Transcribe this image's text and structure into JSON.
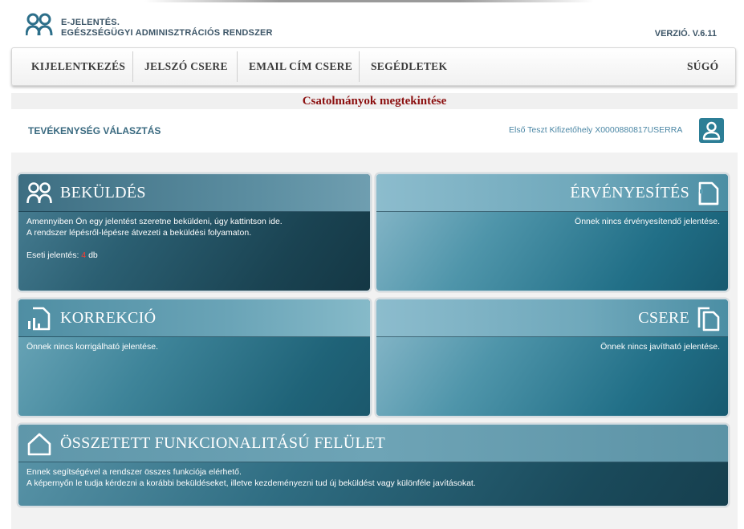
{
  "header": {
    "brand_line1": "E-JELENTÉS.",
    "brand_line2": "EGÉSZSÉGÜGYI ADMINISZTRÁCIÓS RENDSZER",
    "version": "VERZIÓ. V.6.11"
  },
  "nav": {
    "items": [
      {
        "label": "KIJELENTKEZÉS"
      },
      {
        "label": "JELSZÓ CSERE"
      },
      {
        "label": "EMAIL CÍM CSERE"
      },
      {
        "label": "SEGÉDLETEK"
      }
    ],
    "help": "SÚGÓ"
  },
  "banner": {
    "label": "Csatolmányok megtekintése"
  },
  "activity": {
    "label": "TEVÉKENYSÉG VÁLASZTÁS",
    "user": "Első Teszt Kifizetőhely X0000880817USERRA"
  },
  "cards": {
    "bekuldes": {
      "title": "BEKÜLDÉS",
      "line1": "Amennyiben Ön egy jelentést szeretne beküldeni, úgy kattintson ide.",
      "line2": "A rendszer lépésről-lépésre átvezeti a beküldési folyamaton.",
      "count_label": "Eseti jelentés:",
      "count_value": "4",
      "count_unit": "db"
    },
    "ervenyesites": {
      "title": "ÉRVÉNYESÍTÉS",
      "text": "Önnek nincs érvényesítendő jelentése."
    },
    "korrekcio": {
      "title": "KORREKCIÓ",
      "text": "Önnek nincs korrigálható jelentése."
    },
    "csere": {
      "title": "CSERE",
      "text": "Önnek nincs javítható jelentése."
    },
    "osszetett": {
      "title": "ÖSSZETETT FUNKCIONALITÁSÚ FELÜLET",
      "line1": "Ennek segítségével a rendszer összes funkciója elérhető.",
      "line2": "A képernyőn le tudja kérdezni a korábbi beküldéseket, illetve kezdeményezni tud új beküldést vagy különféle javításokat."
    }
  },
  "icons": [
    "people-icon",
    "document-corner-icon",
    "chart-document-icon",
    "copy-documents-icon",
    "home-icon",
    "user-icon"
  ],
  "colors": {
    "accent": "#2c7e96",
    "banner_text": "#8b0f0f",
    "count_highlight": "#ff3b2f"
  }
}
